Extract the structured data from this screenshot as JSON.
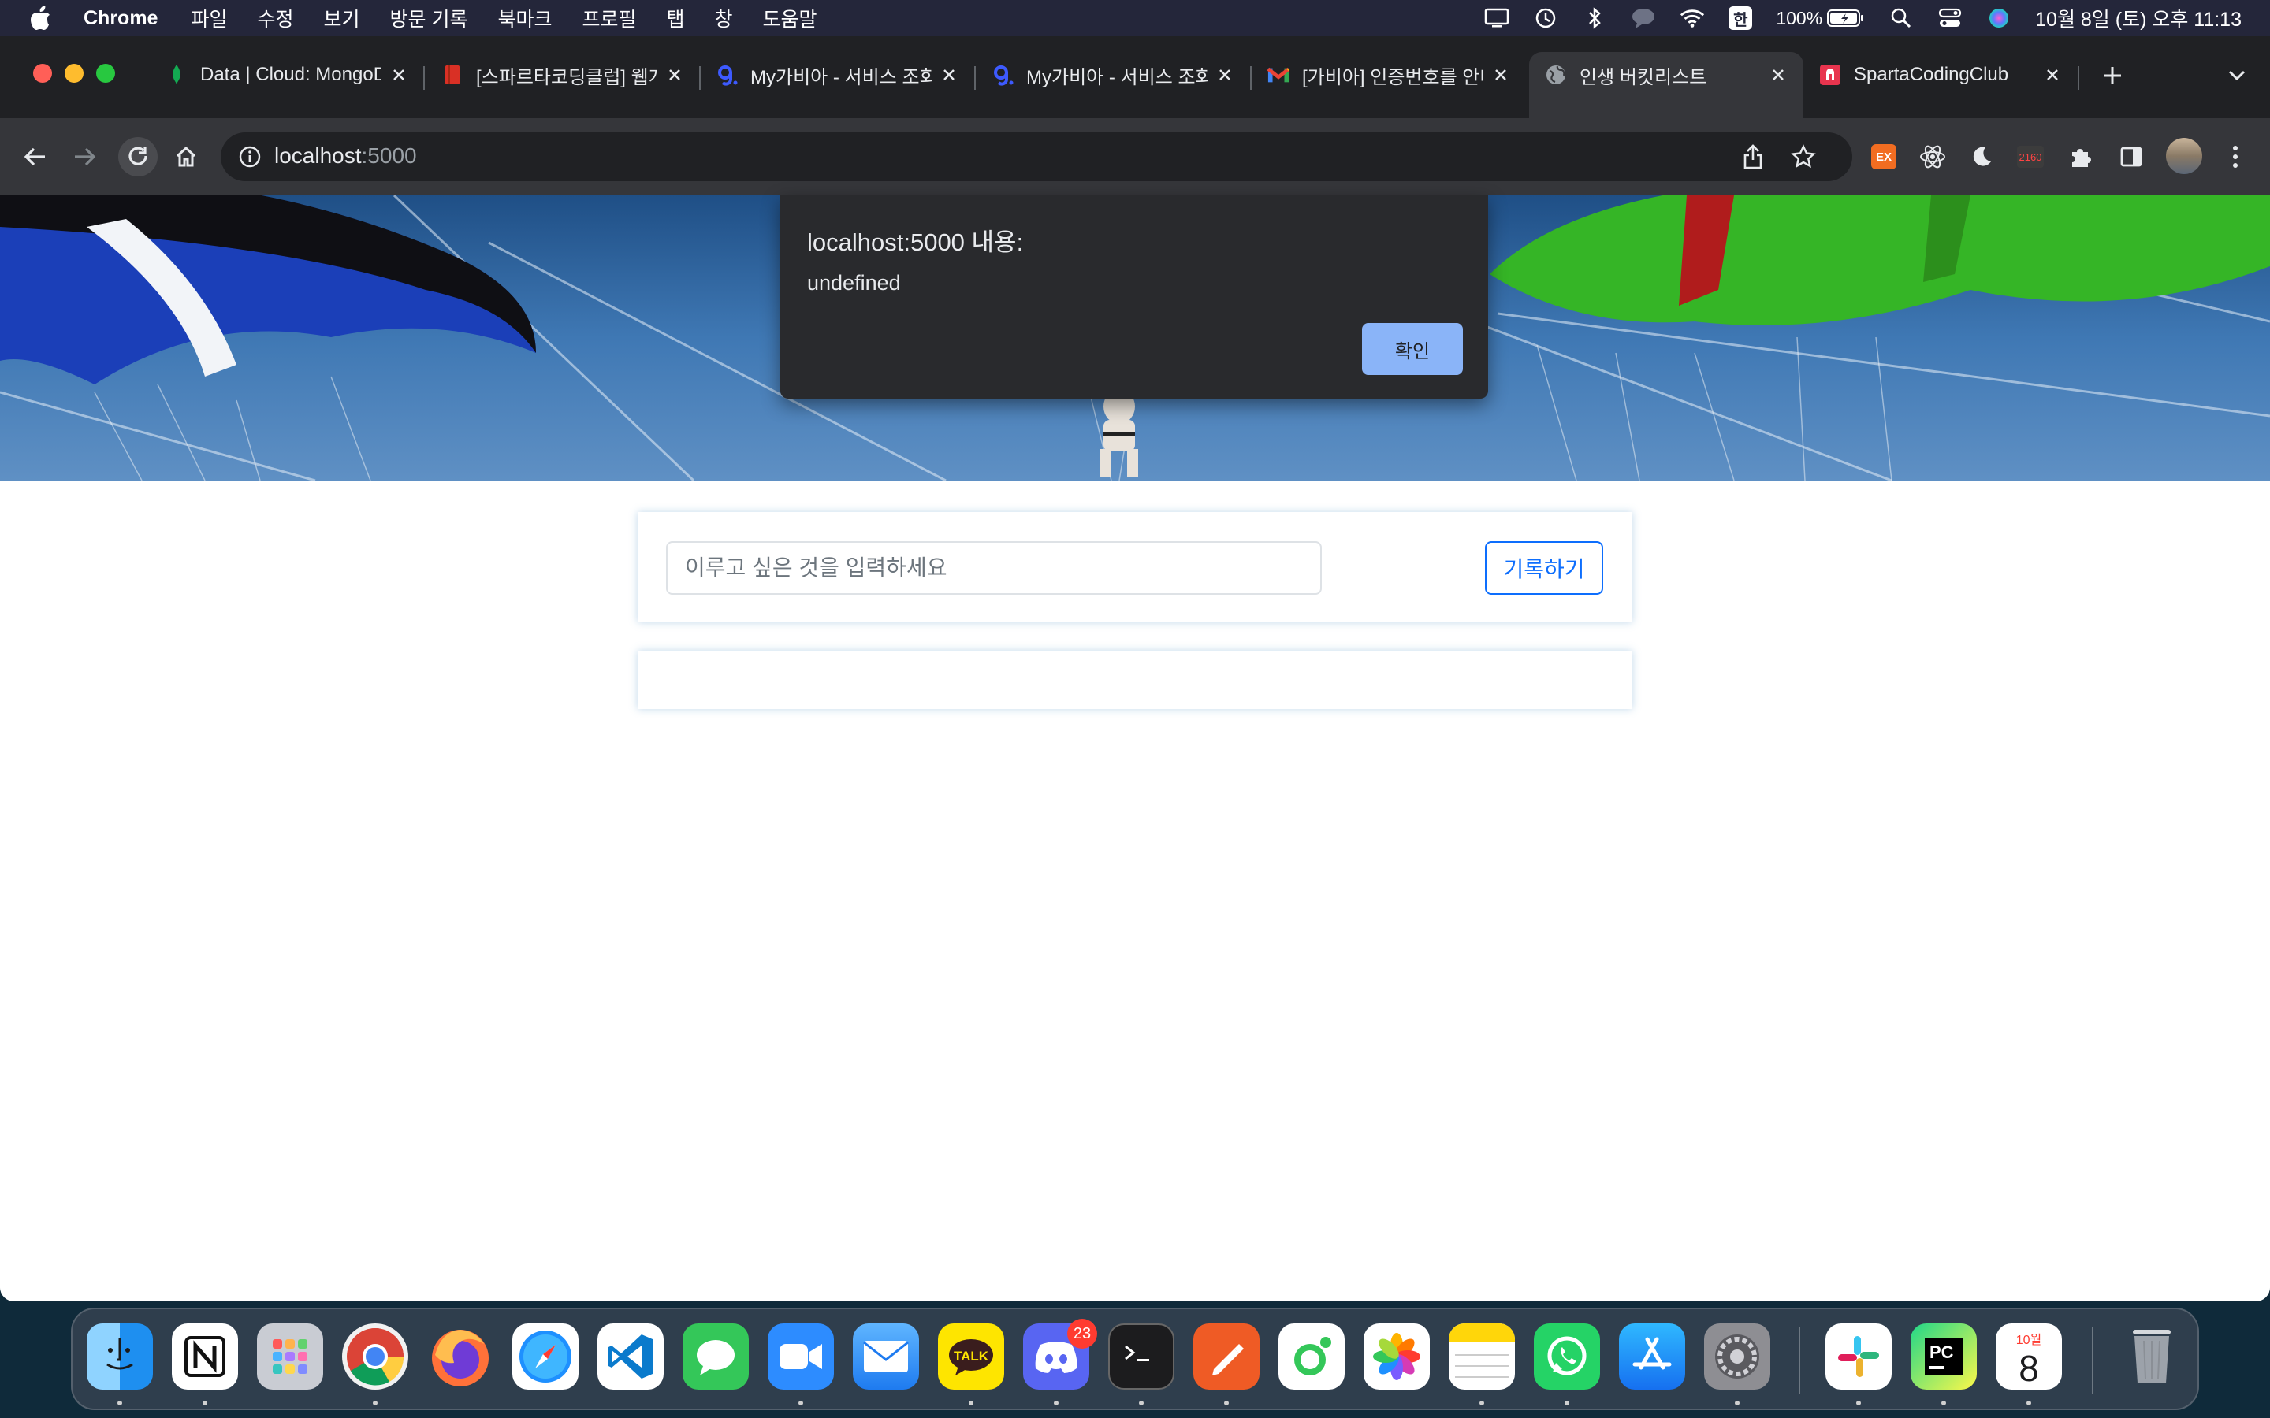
{
  "menubar": {
    "app_name": "Chrome",
    "menus": [
      "파일",
      "수정",
      "보기",
      "방문 기록",
      "북마크",
      "프로필",
      "탭",
      "창",
      "도움말"
    ],
    "input_source": "한",
    "battery": "100%",
    "datetime": "10월 8일 (토) 오후 11:13"
  },
  "tabs": [
    {
      "title": "Data | Cloud: MongoDB",
      "icon": "mongodb-leaf-icon"
    },
    {
      "title": "[스파르타코딩클럽] 웹개발",
      "icon": "book-icon"
    },
    {
      "title": "My가비아 - 서비스 조회",
      "icon": "gabia-icon"
    },
    {
      "title": "My가비아 - 서비스 조회",
      "icon": "gabia-icon"
    },
    {
      "title": "[가비아] 인증번호를 안내",
      "icon": "gmail-icon"
    },
    {
      "title": "인생 버킷리스트",
      "icon": "globe-icon"
    },
    {
      "title": "SpartaCodingClub",
      "icon": "sparta-icon"
    }
  ],
  "address": {
    "host": "localhost",
    "port": ":5000"
  },
  "alert": {
    "title": "localhost:5000 내용:",
    "message": "undefined",
    "ok_label": "확인"
  },
  "form": {
    "placeholder": "이루고 싶은 것을 입력하세요",
    "value": "",
    "save_label": "기록하기"
  },
  "extensions": {
    "counter_badge": "2160",
    "ex_label": "EX"
  },
  "dock": {
    "apps": [
      "Finder",
      "Notion",
      "Launchpad",
      "Chrome",
      "Firefox",
      "Safari",
      "VS Code",
      "Messages",
      "Zoom",
      "Mail",
      "KakaoTalk",
      "Discord",
      "Terminal",
      "Postman",
      "Mindnode",
      "Photos",
      "Notes",
      "WhatsApp",
      "App Store",
      "System Preferences",
      "Slack",
      "PyCharm",
      "Calendar",
      "Trash"
    ],
    "discord_badge": "23",
    "calendar_month": "10월",
    "calendar_day": "8"
  },
  "colors": {
    "accent": "#0d6efd",
    "alert_button": "#8ab4f8",
    "chrome_dark": "#35363a"
  }
}
